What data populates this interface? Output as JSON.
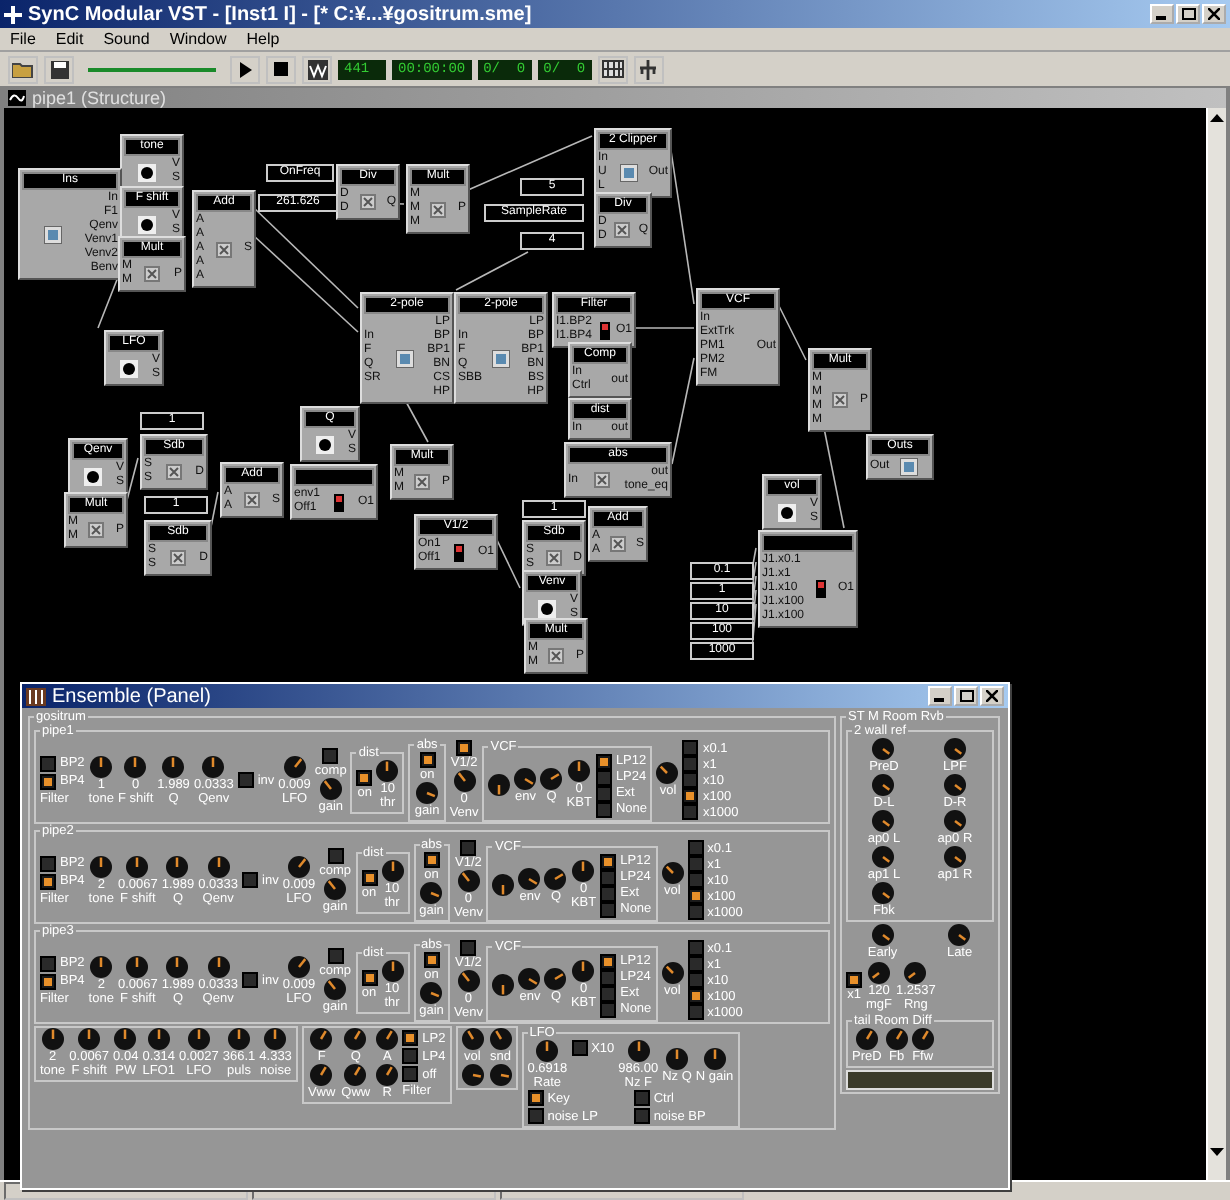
{
  "window": {
    "title": "SynC Modular VST - [Inst1 I] - [* C:¥...¥gositrum.sme]"
  },
  "menu": [
    "File",
    "Edit",
    "Sound",
    "Window",
    "Help"
  ],
  "toolbar": {
    "displays": [
      "441",
      "00:00:00",
      "0/  0",
      "0/  0"
    ]
  },
  "structure": {
    "title": "pipe1 (Structure)",
    "nodes": [
      {
        "kind": "module",
        "title": "tone",
        "outputs": [
          "V",
          "S"
        ]
      },
      {
        "kind": "module",
        "title": "2 Clipper",
        "inputs": [
          "In",
          "U",
          "L"
        ],
        "outputs": [
          "Out"
        ]
      },
      {
        "kind": "module",
        "title": "Ins",
        "outputs": [
          "In",
          "F1",
          "Qenv",
          "Venv1",
          "Venv2",
          "Benv"
        ]
      },
      {
        "kind": "constant",
        "text": "OnFreq"
      },
      {
        "kind": "module",
        "title": "Div",
        "inputs": [
          "D",
          "D"
        ],
        "outputs": [
          "Q"
        ]
      },
      {
        "kind": "module",
        "title": "Mult",
        "inputs": [
          "M",
          "M",
          "M"
        ],
        "outputs": [
          "P"
        ]
      },
      {
        "kind": "constant",
        "text": "5"
      },
      {
        "kind": "module",
        "title": "F shift",
        "outputs": [
          "V",
          "S"
        ]
      },
      {
        "kind": "module",
        "title": "Add",
        "inputs": [
          "A",
          "A",
          "A",
          "A",
          "A"
        ],
        "outputs": [
          "S"
        ]
      },
      {
        "kind": "constant",
        "text": "261.626"
      },
      {
        "kind": "module",
        "title": "Div",
        "inputs": [
          "D",
          "D"
        ],
        "outputs": [
          "Q"
        ]
      },
      {
        "kind": "constant",
        "text": "SampleRate"
      },
      {
        "kind": "constant",
        "text": "4"
      },
      {
        "kind": "module",
        "title": "Mult",
        "inputs": [
          "M",
          "M"
        ],
        "outputs": [
          "P"
        ]
      },
      {
        "kind": "module",
        "title": "LFO",
        "outputs": [
          "V",
          "S"
        ]
      },
      {
        "kind": "module",
        "title": "2-pole",
        "inputs": [
          "In",
          "F",
          "Q",
          "SR"
        ],
        "outputs": [
          "LP",
          "BP",
          "BP1",
          "BN",
          "CS",
          "HP"
        ]
      },
      {
        "kind": "module",
        "title": "2-pole",
        "inputs": [
          "In",
          "F",
          "Q",
          "SBB"
        ],
        "outputs": [
          "LP",
          "BP",
          "BP1",
          "BN",
          "BS",
          "HP"
        ]
      },
      {
        "kind": "module",
        "title": "Filter",
        "inputs": [
          "I1.BP2",
          "I1.BP4"
        ],
        "outputs": [
          "O1"
        ]
      },
      {
        "kind": "module",
        "title": "Comp",
        "inputs": [
          "In",
          "Ctrl"
        ],
        "outputs": [
          "out"
        ]
      },
      {
        "kind": "module",
        "title": "VCF",
        "inputs": [
          "In",
          "ExtTrk",
          "PM1",
          "PM2",
          "FM"
        ],
        "outputs": [
          "Out"
        ]
      },
      {
        "kind": "constant",
        "text": "1"
      },
      {
        "kind": "module",
        "title": "Q",
        "outputs": [
          "V",
          "S"
        ]
      },
      {
        "kind": "module",
        "title": "dist",
        "inputs": [
          "In"
        ],
        "outputs": [
          "out"
        ]
      },
      {
        "kind": "module",
        "title": "Mult",
        "inputs": [
          "M",
          "M",
          "M",
          "M"
        ],
        "outputs": [
          "P"
        ]
      },
      {
        "kind": "module",
        "title": "Qenv",
        "outputs": [
          "V",
          "S"
        ]
      },
      {
        "kind": "module",
        "title": "Sdb",
        "inputs": [
          "S",
          "S"
        ],
        "outputs": [
          "D"
        ]
      },
      {
        "kind": "module",
        "title": "Mult",
        "inputs": [
          "M",
          "M"
        ],
        "outputs": [
          "P"
        ]
      },
      {
        "kind": "module",
        "title": "abs",
        "inputs": [
          "In"
        ],
        "outputs": [
          "out",
          "tone_eq"
        ]
      },
      {
        "kind": "module",
        "title": "Outs",
        "inputs": [
          "Out"
        ]
      },
      {
        "kind": "module",
        "title": "Add",
        "inputs": [
          "A",
          "A"
        ],
        "outputs": [
          "S"
        ]
      },
      {
        "kind": "module",
        "inputs": [
          "env1",
          "Off1"
        ],
        "outputs": [
          "O1"
        ]
      },
      {
        "kind": "module",
        "title": "vol",
        "outputs": [
          "V",
          "S"
        ]
      },
      {
        "kind": "module",
        "title": "Mult",
        "inputs": [
          "M",
          "M"
        ],
        "outputs": [
          "P"
        ]
      },
      {
        "kind": "constant",
        "text": "1"
      },
      {
        "kind": "constant",
        "text": "1"
      },
      {
        "kind": "module",
        "title": "Add",
        "inputs": [
          "A",
          "A"
        ],
        "outputs": [
          "S"
        ]
      },
      {
        "kind": "module",
        "title": "Sdb",
        "inputs": [
          "S",
          "S"
        ],
        "outputs": [
          "D"
        ]
      },
      {
        "kind": "module",
        "title": "V1/2",
        "inputs": [
          "On1",
          "Off1"
        ],
        "outputs": [
          "O1"
        ]
      },
      {
        "kind": "module",
        "title": "Sdb",
        "inputs": [
          "S",
          "S"
        ],
        "outputs": [
          "D"
        ]
      },
      {
        "kind": "module",
        "inputs": [
          "J1.x0.1",
          "J1.x1",
          "J1.x10",
          "J1.x100",
          "J1.x100"
        ],
        "outputs": [
          "O1"
        ]
      },
      {
        "kind": "constant",
        "text": "0.1"
      },
      {
        "kind": "module",
        "title": "Venv",
        "outputs": [
          "V",
          "S"
        ]
      },
      {
        "kind": "constant",
        "text": "1"
      },
      {
        "kind": "constant",
        "text": "10"
      },
      {
        "kind": "module",
        "title": "Mult",
        "inputs": [
          "M",
          "M"
        ],
        "outputs": [
          "P"
        ]
      },
      {
        "kind": "constant",
        "text": "100"
      },
      {
        "kind": "constant",
        "text": "1000"
      }
    ]
  },
  "panel": {
    "title": "Ensemble (Panel)",
    "group_title": "gositrum",
    "pipes": [
      {
        "title": "pipe1",
        "filter": {
          "label": "Filter",
          "options": [
            {
              "label": "BP2",
              "selected": false
            },
            {
              "label": "BP4",
              "selected": true
            }
          ]
        },
        "knobs": [
          {
            "value": "1",
            "label": "tone"
          },
          {
            "value": "0",
            "label": "F shift"
          },
          {
            "value": "1.989",
            "label": "Q"
          },
          {
            "value": "0.0333",
            "label": "Qenv"
          }
        ],
        "inv": {
          "label": "inv",
          "on": false
        },
        "lfo": {
          "value": "0.009",
          "label": "LFO"
        },
        "comp": {
          "label": "comp",
          "on": false,
          "gain_label": "gain"
        },
        "dist": {
          "title": "dist",
          "on_label": "on",
          "on": true,
          "value": "10",
          "label": "thr"
        },
        "abs": {
          "title": "abs",
          "on_label": "on",
          "on": true,
          "gain_label": "gain"
        },
        "v12": {
          "label": "V1/2",
          "on": true,
          "value": "0",
          "knob_label": "Venv"
        },
        "vcf": {
          "title": "VCF",
          "q_label": "Q",
          "kbt_value": "0",
          "kbt_label": "KBT",
          "env_label": "env",
          "types": [
            {
              "label": "LP12",
              "selected": true
            },
            {
              "label": "LP24",
              "selected": false
            },
            {
              "label": "Ext",
              "selected": false
            },
            {
              "label": "None",
              "selected": false
            }
          ]
        },
        "vol_label": "vol",
        "ranges": [
          {
            "label": "x0.1",
            "selected": false
          },
          {
            "label": "x1",
            "selected": false
          },
          {
            "label": "x10",
            "selected": false
          },
          {
            "label": "x100",
            "selected": true
          },
          {
            "label": "x1000",
            "selected": false
          }
        ]
      },
      {
        "title": "pipe2",
        "filter": {
          "label": "Filter",
          "options": [
            {
              "label": "BP2",
              "selected": false
            },
            {
              "label": "BP4",
              "selected": true
            }
          ]
        },
        "knobs": [
          {
            "value": "2",
            "label": "tone"
          },
          {
            "value": "0.0067",
            "label": "F shift"
          },
          {
            "value": "1.989",
            "label": "Q"
          },
          {
            "value": "0.0333",
            "label": "Qenv"
          }
        ],
        "inv": {
          "label": "inv",
          "on": false
        },
        "lfo": {
          "value": "0.009",
          "label": "LFO"
        },
        "comp": {
          "label": "comp",
          "on": false,
          "gain_label": "gain"
        },
        "dist": {
          "title": "dist",
          "on_label": "on",
          "on": true,
          "value": "10",
          "label": "thr"
        },
        "abs": {
          "title": "abs",
          "on_label": "on",
          "on": true,
          "gain_label": "gain"
        },
        "v12": {
          "label": "V1/2",
          "on": false,
          "value": "0",
          "knob_label": "Venv"
        },
        "vcf": {
          "title": "VCF",
          "q_label": "Q",
          "kbt_value": "0",
          "kbt_label": "KBT",
          "env_label": "env",
          "types": [
            {
              "label": "LP12",
              "selected": true
            },
            {
              "label": "LP24",
              "selected": false
            },
            {
              "label": "Ext",
              "selected": false
            },
            {
              "label": "None",
              "selected": false
            }
          ]
        },
        "vol_label": "vol",
        "ranges": [
          {
            "label": "x0.1",
            "selected": false
          },
          {
            "label": "x1",
            "selected": false
          },
          {
            "label": "x10",
            "selected": false
          },
          {
            "label": "x100",
            "selected": true
          },
          {
            "label": "x1000",
            "selected": false
          }
        ]
      },
      {
        "title": "pipe3",
        "filter": {
          "label": "Filter",
          "options": [
            {
              "label": "BP2",
              "selected": false
            },
            {
              "label": "BP4",
              "selected": true
            }
          ]
        },
        "knobs": [
          {
            "value": "2",
            "label": "tone"
          },
          {
            "value": "0.0067",
            "label": "F shift"
          },
          {
            "value": "1.989",
            "label": "Q"
          },
          {
            "value": "0.0333",
            "label": "Qenv"
          }
        ],
        "inv": {
          "label": "inv",
          "on": false
        },
        "lfo": {
          "value": "0.009",
          "label": "LFO"
        },
        "comp": {
          "label": "comp",
          "on": false,
          "gain_label": "gain"
        },
        "dist": {
          "title": "dist",
          "on_label": "on",
          "on": true,
          "value": "10",
          "label": "thr"
        },
        "abs": {
          "title": "abs",
          "on_label": "on",
          "on": true,
          "gain_label": "gain"
        },
        "v12": {
          "label": "V1/2",
          "on": false,
          "value": "0",
          "knob_label": "Venv"
        },
        "vcf": {
          "title": "VCF",
          "q_label": "Q",
          "kbt_value": "0",
          "kbt_label": "KBT",
          "env_label": "env",
          "types": [
            {
              "label": "LP12",
              "selected": true
            },
            {
              "label": "LP24",
              "selected": false
            },
            {
              "label": "Ext",
              "selected": false
            },
            {
              "label": "None",
              "selected": false
            }
          ]
        },
        "vol_label": "vol",
        "ranges": [
          {
            "label": "x0.1",
            "selected": false
          },
          {
            "label": "x1",
            "selected": false
          },
          {
            "label": "x10",
            "selected": false
          },
          {
            "label": "x100",
            "selected": true
          },
          {
            "label": "x1000",
            "selected": false
          }
        ]
      }
    ],
    "tone_group": {
      "knobs": [
        {
          "value": "2",
          "label": "tone"
        },
        {
          "value": "0.0067",
          "label": "F shift"
        },
        {
          "value": "0.04",
          "label": "PW"
        },
        {
          "value": "0.314",
          "label": "LFO1"
        },
        {
          "value": "0.0027",
          "label": "LFO"
        },
        {
          "value": "366.1",
          "label": "puls"
        },
        {
          "value": "4.333",
          "label": "noise"
        }
      ]
    },
    "noise_filter": {
      "knobs": [
        {
          "label": "F"
        },
        {
          "label": "Q"
        },
        {
          "label": "A"
        },
        {
          "label": "Vww"
        },
        {
          "label": "Qww"
        },
        {
          "label": "R"
        }
      ],
      "options": [
        {
          "label": "LP2",
          "selected": true
        },
        {
          "label": "LP4",
          "selected": false
        },
        {
          "label": "off",
          "selected": false
        }
      ],
      "label": "Filter"
    },
    "out_group": {
      "knobs": [
        {
          "label": "vol"
        },
        {
          "label": "snd"
        }
      ]
    },
    "lfo_group": {
      "title": "LFO",
      "knobs": [
        {
          "value": "0.6918",
          "label": "Rate"
        },
        {
          "value": "986.00",
          "label": "Nz F"
        },
        {
          "label": "Nz Q"
        },
        {
          "label": "N gain"
        }
      ],
      "x10": {
        "label": "X10",
        "on": false
      },
      "toggles": [
        {
          "label": "Key",
          "on": true
        },
        {
          "label": "Ctrl",
          "on": false
        },
        {
          "label": "noise LP",
          "on": false
        },
        {
          "label": "noise BP",
          "on": false
        }
      ]
    },
    "reverb": {
      "title": "ST M Room Rvb",
      "wall": {
        "title": "2 wall ref",
        "knobs": [
          "PreD",
          "LPF",
          "D-L",
          "D-R",
          "ap0 L",
          "ap0 R",
          "ap1 L",
          "ap1 R",
          "Fbk"
        ]
      },
      "early_late": [
        "Early",
        "Late"
      ],
      "x1": {
        "label": "x1",
        "on": true
      },
      "knobs": [
        {
          "value": "120",
          "label": "mgF"
        },
        {
          "value": "1.2537",
          "label": "Rng"
        }
      ],
      "tail": {
        "title": "tail Room Diff",
        "knobs": [
          "PreD",
          "Fb",
          "Ffw"
        ]
      }
    }
  }
}
